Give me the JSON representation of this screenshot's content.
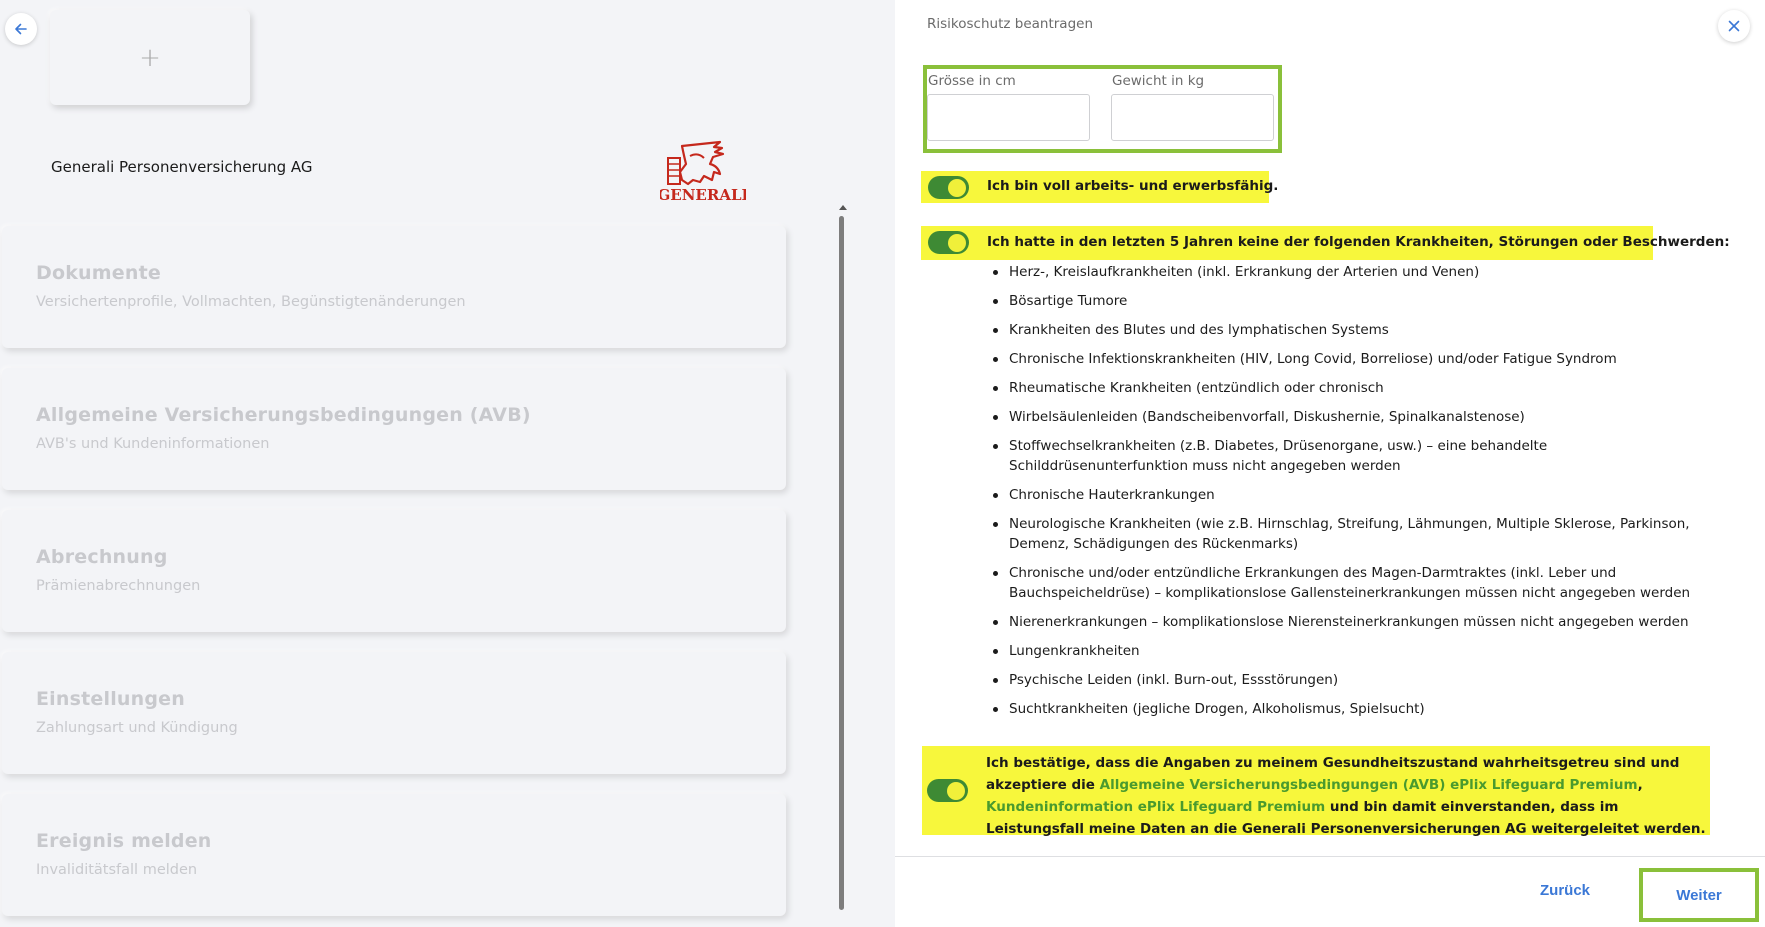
{
  "left": {
    "add_symbol": "+",
    "company_name": "Generali Personenversicherung AG",
    "logo_text": "GENERALI",
    "cards": [
      {
        "title": "Dokumente",
        "subtitle": "Versichertenprofile, Vollmachten, Begünstigtenänderungen"
      },
      {
        "title": "Allgemeine Versicherungsbedingungen (AVB)",
        "subtitle": "AVB's und Kundeninformationen"
      },
      {
        "title": "Abrechnung",
        "subtitle": "Prämienabrechnungen"
      },
      {
        "title": "Einstellungen",
        "subtitle": "Zahlungsart und Kündigung"
      },
      {
        "title": "Ereignis melden",
        "subtitle": "Invaliditätsfall melden"
      }
    ]
  },
  "dialog": {
    "title": "Risikoschutz beantragen",
    "height_label": "Grösse in cm",
    "height_value": "",
    "weight_label": "Gewicht in kg",
    "weight_value": "",
    "toggle1_label": "Ich bin voll arbeits- und erwerbsfähig.",
    "toggle2_label": "Ich hatte in den letzten 5 Jahren keine der folgenden Krankheiten, Störungen oder Beschwerden:",
    "diseases": [
      "Herz-, Kreislaufkrankheiten (inkl. Erkrankung der Arterien und Venen)",
      "Bösartige Tumore",
      "Krankheiten des Blutes und des lymphatischen Systems",
      "Chronische Infektionskrankheiten (HIV, Long Covid, Borreliose) und/oder Fatigue Syndrom",
      "Rheumatische Krankheiten (entzündlich oder chronisch",
      "Wirbelsäulenleiden (Bandscheibenvorfall, Diskushernie, Spinalkanalstenose)",
      "Stoffwechselkrankheiten (z.B. Diabetes, Drüsenorgane, usw.) – eine behandelte Schilddrüsenunterfunktion muss nicht angegeben werden",
      "Chronische Hauterkrankungen",
      "Neurologische Krankheiten (wie z.B. Hirnschlag, Streifung, Lähmungen, Multiple Sklerose, Parkinson, Demenz, Schädigungen des Rückenmarks)",
      "Chronische und/oder entzündliche Erkrankungen des Magen-Darmtraktes (inkl. Leber und Bauchspeicheldrüse) – komplikationslose Gallensteinerkrankungen müssen nicht angegeben werden",
      "Nierenerkrankungen – komplikationslose Nierensteinerkrankungen müssen nicht angegeben werden",
      "Lungenkrankheiten",
      "Psychische Leiden (inkl. Burn-out, Essstörungen)",
      "Suchtkrankheiten (jegliche Drogen, Alkoholismus, Spielsucht)"
    ],
    "confirm": {
      "text_start": "Ich bestätige, dass die Angaben zu meinem Gesundheitszustand wahrheitsgetreu sind und akzeptiere die ",
      "link_avb": "Allgemeine Versicherungsbedingungen (AVB) ePlix Lifeguard Premium",
      "separator": ", ",
      "link_kundeninfo": "Kundeninformation ePlix Lifeguard Premium",
      "text_end": " und bin damit einverstanden, dass im Leistungsfall meine Daten an die Generali Personenversicherungen AG weitergeleitet werden."
    },
    "back_label": "Zurück",
    "next_label": "Weiter"
  },
  "colors": {
    "highlight": "#f7f73c",
    "toggle_on": "#3e8a34",
    "frame_green": "#8ac03a",
    "link_blue": "#3b78d6",
    "logo_red": "#c5281c"
  },
  "icons": {
    "back": "arrow-left-icon",
    "close": "close-icon",
    "add": "plus-icon"
  }
}
